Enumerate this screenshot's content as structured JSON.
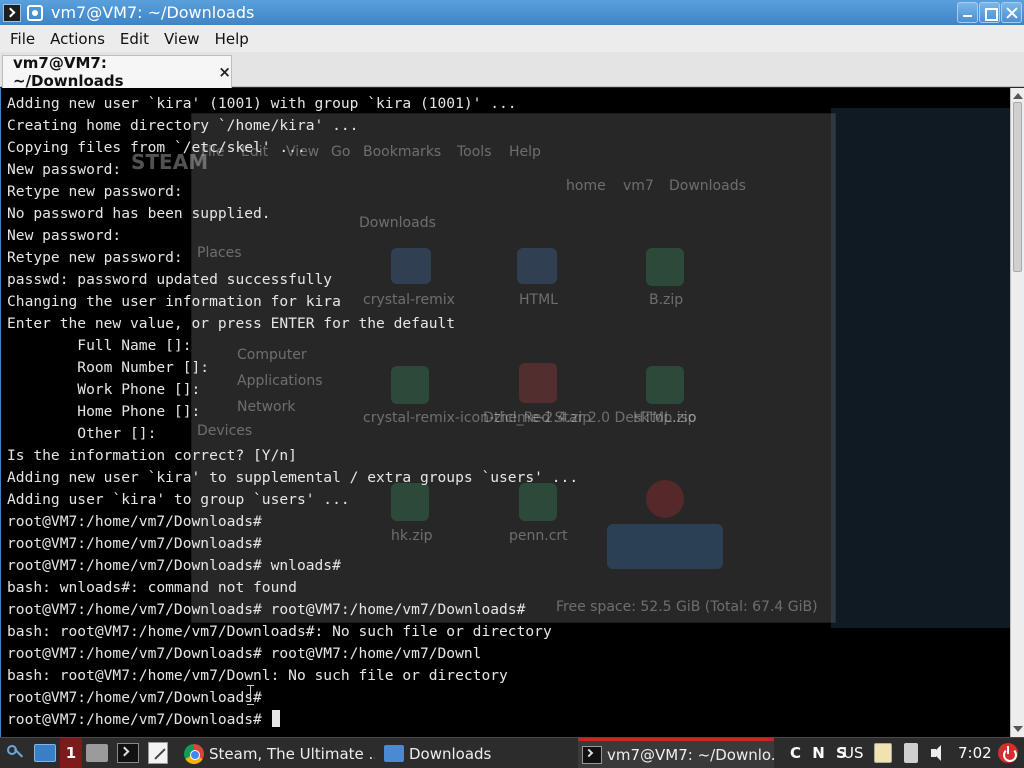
{
  "window": {
    "title": "vm7@VM7: ~/Downloads"
  },
  "menubar": {
    "items": [
      "File",
      "Actions",
      "Edit",
      "View",
      "Help"
    ]
  },
  "tabs": [
    {
      "label": "vm7@VM7: ~/Downloads",
      "close": "×"
    }
  ],
  "terminal": {
    "lines": [
      "Adding new user `kira' (1001) with group `kira (1001)' ...",
      "Creating home directory `/home/kira' ...",
      "Copying files from `/etc/skel' ...",
      "New password:",
      "Retype new password:",
      "No password has been supplied.",
      "New password:",
      "Retype new password:",
      "passwd: password updated successfully",
      "Changing the user information for kira",
      "Enter the new value, or press ENTER for the default",
      "        Full Name []:",
      "        Room Number []:",
      "        Work Phone []:",
      "        Home Phone []:",
      "        Other []:",
      "Is the information correct? [Y/n]",
      "Adding new user `kira' to supplemental / extra groups `users' ...",
      "Adding user `kira' to group `users' ...",
      "root@VM7:/home/vm7/Downloads#",
      "root@VM7:/home/vm7/Downloads#",
      "root@VM7:/home/vm7/Downloads# wnloads#",
      "bash: wnloads#: command not found",
      "root@VM7:/home/vm7/Downloads# root@VM7:/home/vm7/Downloads#",
      "bash: root@VM7:/home/vm7/Downloads#: No such file or directory",
      "root@VM7:/home/vm7/Downloads# root@VM7:/home/vm7/Downl",
      "bash: root@VM7:/home/vm7/Downl: No such file or directory",
      "root@VM7:/home/vm7/Downloads#",
      "root@VM7:/home/vm7/Downloads# "
    ]
  },
  "background_ghost": {
    "file_manager_menu": [
      "File",
      "Edit",
      "View",
      "Go",
      "Bookmarks",
      "Tools",
      "Help"
    ],
    "breadcrumb": [
      "home",
      "vm7",
      "Downloads"
    ],
    "tab": "Downloads",
    "places_header": "Places",
    "places": [
      "Computer",
      "Applications",
      "Network"
    ],
    "devices_header": "Devices",
    "files": [
      "crystal-remix",
      "HTML",
      "B.zip",
      "crystal-remix-icon-theme-2.4.zip",
      "Dzicl_Red Star 2.0 Desktop.iso",
      "HTML.zip",
      "hk.zip",
      "penn.crt"
    ],
    "status": "Free space: 52.5 GiB (Total: 67.4 GiB)",
    "steam_label": "STEAM"
  },
  "taskbar": {
    "workspace": "1",
    "tasks": [
      {
        "label": "Steam, The Ultimate ...",
        "icon": "chrome-icon"
      },
      {
        "label": "Downloads",
        "icon": "folder-icon"
      },
      {
        "label": "vm7@VM7: ~/Downlo...",
        "icon": "terminal-icon",
        "active": true
      }
    ],
    "keyboard_indicators": "C N S",
    "language": "US",
    "clock": "7:02"
  },
  "colors": {
    "titlebar": "#4a8fd0",
    "terminal_bg": "#000000",
    "terminal_fg": "#e6e6e6",
    "active_task_accent": "#c62828"
  }
}
